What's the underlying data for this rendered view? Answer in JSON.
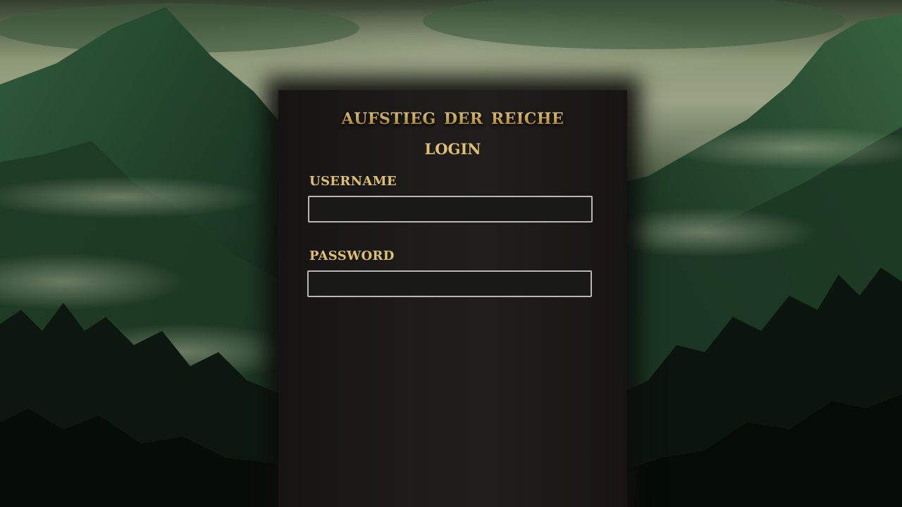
{
  "app": {
    "title": "Aufstieg der Reiche"
  },
  "login": {
    "heading": "Login",
    "username": {
      "label": "Username",
      "value": ""
    },
    "password": {
      "label": "Password",
      "value": ""
    }
  },
  "colors": {
    "gold": "#e1c06d",
    "panel": "#1d1c1b",
    "field_border": "#b9b7b2"
  }
}
